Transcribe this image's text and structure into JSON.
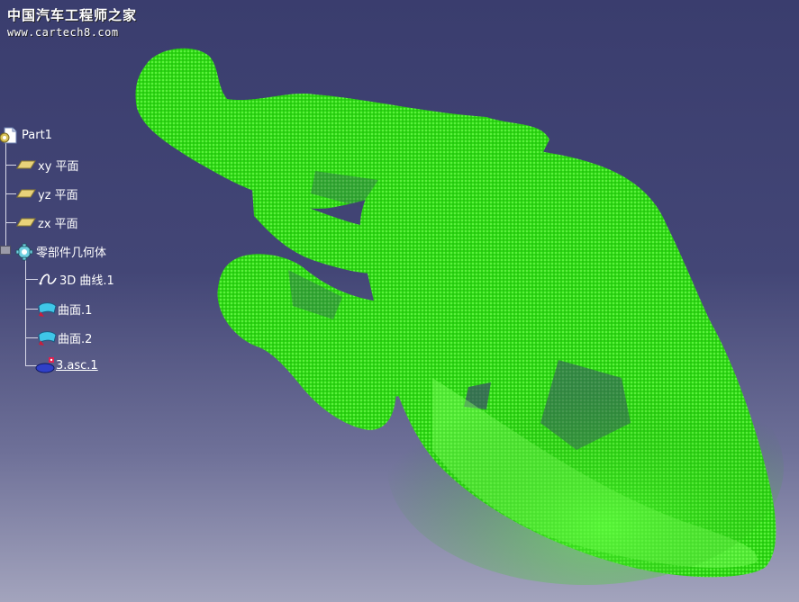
{
  "watermark": {
    "title": "中国汽车工程师之家",
    "url": "www.cartech8.com"
  },
  "tree": {
    "root": {
      "label": "Part1",
      "icon": "part-document-icon"
    },
    "planes": [
      {
        "label": "xy 平面",
        "icon": "plane-icon"
      },
      {
        "label": "yz 平面",
        "icon": "plane-icon"
      },
      {
        "label": "zx 平面",
        "icon": "plane-icon"
      }
    ],
    "body": {
      "label": "零部件几何体",
      "icon": "part-body-gear-icon",
      "children": [
        {
          "label": "3D 曲线.1",
          "icon": "3d-curve-icon"
        },
        {
          "label": "曲面.1",
          "icon": "surface-icon"
        },
        {
          "label": "曲面.2",
          "icon": "surface-icon"
        },
        {
          "label": "3.asc.1",
          "icon": "point-cloud-icon",
          "selected": true
        }
      ]
    }
  },
  "colors": {
    "point_cloud": "#33ff1a",
    "background_top": "#3a3d6e",
    "background_bottom": "#a3a4bd",
    "plane_icon": "#e8d27a",
    "surface_icon": "#3fc7e8"
  }
}
